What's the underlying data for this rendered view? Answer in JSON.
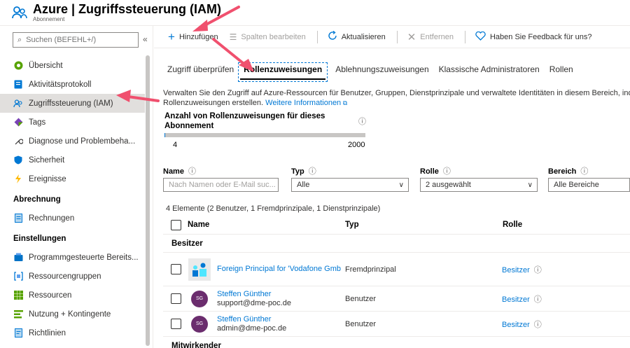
{
  "header": {
    "title": "Azure | Zugriffssteuerung (IAM)",
    "subtitle": "Abonnement"
  },
  "sidebar": {
    "search_placeholder": "Suchen (BEFEHL+/)",
    "collapse_glyph": "«",
    "items": [
      {
        "label": "Übersicht",
        "icon": "overview-icon"
      },
      {
        "label": "Aktivitätsprotokoll",
        "icon": "activity-log-icon"
      },
      {
        "label": "Zugriffssteuerung (IAM)",
        "icon": "iam-icon",
        "active": true
      },
      {
        "label": "Tags",
        "icon": "tag-icon"
      },
      {
        "label": "Diagnose und Problembeha...",
        "icon": "wrench-icon"
      },
      {
        "label": "Sicherheit",
        "icon": "shield-icon"
      },
      {
        "label": "Ereignisse",
        "icon": "lightning-icon"
      }
    ],
    "section_billing": "Abrechnung",
    "billing_items": [
      {
        "label": "Rechnungen",
        "icon": "invoice-icon"
      }
    ],
    "section_settings": "Einstellungen",
    "settings_items": [
      {
        "label": "Programmgesteuerte Bereits...",
        "icon": "deployment-icon"
      },
      {
        "label": "Ressourcengruppen",
        "icon": "resource-group-icon"
      },
      {
        "label": "Ressourcen",
        "icon": "resources-icon"
      },
      {
        "label": "Nutzung + Kontingente",
        "icon": "usage-icon"
      },
      {
        "label": "Richtlinien",
        "icon": "policy-icon"
      }
    ]
  },
  "toolbar": {
    "add": "Hinzufügen",
    "edit_columns": "Spalten bearbeiten",
    "refresh": "Aktualisieren",
    "remove": "Entfernen",
    "feedback": "Haben Sie Feedback für uns?"
  },
  "tabs": [
    "Zugriff überprüfen",
    "Rollenzuweisungen",
    "Ablehnungszuweisungen",
    "Klassische Administratoren",
    "Rollen"
  ],
  "description": {
    "line1": "Verwalten Sie den Zugriff auf Azure-Ressourcen für Benutzer, Gruppen, Dienstprinzipale und verwaltete Identitäten in diesem Bereich, indem",
    "line2": "Rollenzuweisungen erstellen.",
    "more_link": "Weitere Informationen"
  },
  "count": {
    "title": "Anzahl von Rollenzuweisungen für dieses Abonnement",
    "current": "4",
    "max": "2000",
    "fill_fraction": 0.002
  },
  "filters": {
    "name_label": "Name",
    "name_placeholder": "Nach Namen oder E-Mail suc...",
    "type_label": "Typ",
    "type_value": "Alle",
    "role_label": "Rolle",
    "role_value": "2 ausgewählt",
    "scope_label": "Bereich",
    "scope_value": "Alle Bereiche"
  },
  "summary": "4 Elemente (2 Benutzer, 1 Fremdprinzipale, 1 Dienstprinzipale)",
  "table": {
    "col_name": "Name",
    "col_type": "Typ",
    "col_role": "Rolle",
    "group_owner": "Besitzer",
    "group_contributor": "Mitwirkender",
    "rows": [
      {
        "name": "Foreign Principal for 'Vodafone Gmb",
        "email": "",
        "type": "Fremdprinzipal",
        "role": "Besitzer",
        "avatar": ""
      },
      {
        "name": "Steffen Günther",
        "email": "support@dme-poc.de",
        "type": "Benutzer",
        "role": "Besitzer",
        "avatar": "SG"
      },
      {
        "name": "Steffen Günther",
        "email": "admin@dme-poc.de",
        "type": "Benutzer",
        "role": "Besitzer",
        "avatar": "SG"
      }
    ]
  },
  "colors": {
    "accent": "#0078d4",
    "annotation_arrow": "#f0506e",
    "avatar": "#6b2d6e"
  }
}
